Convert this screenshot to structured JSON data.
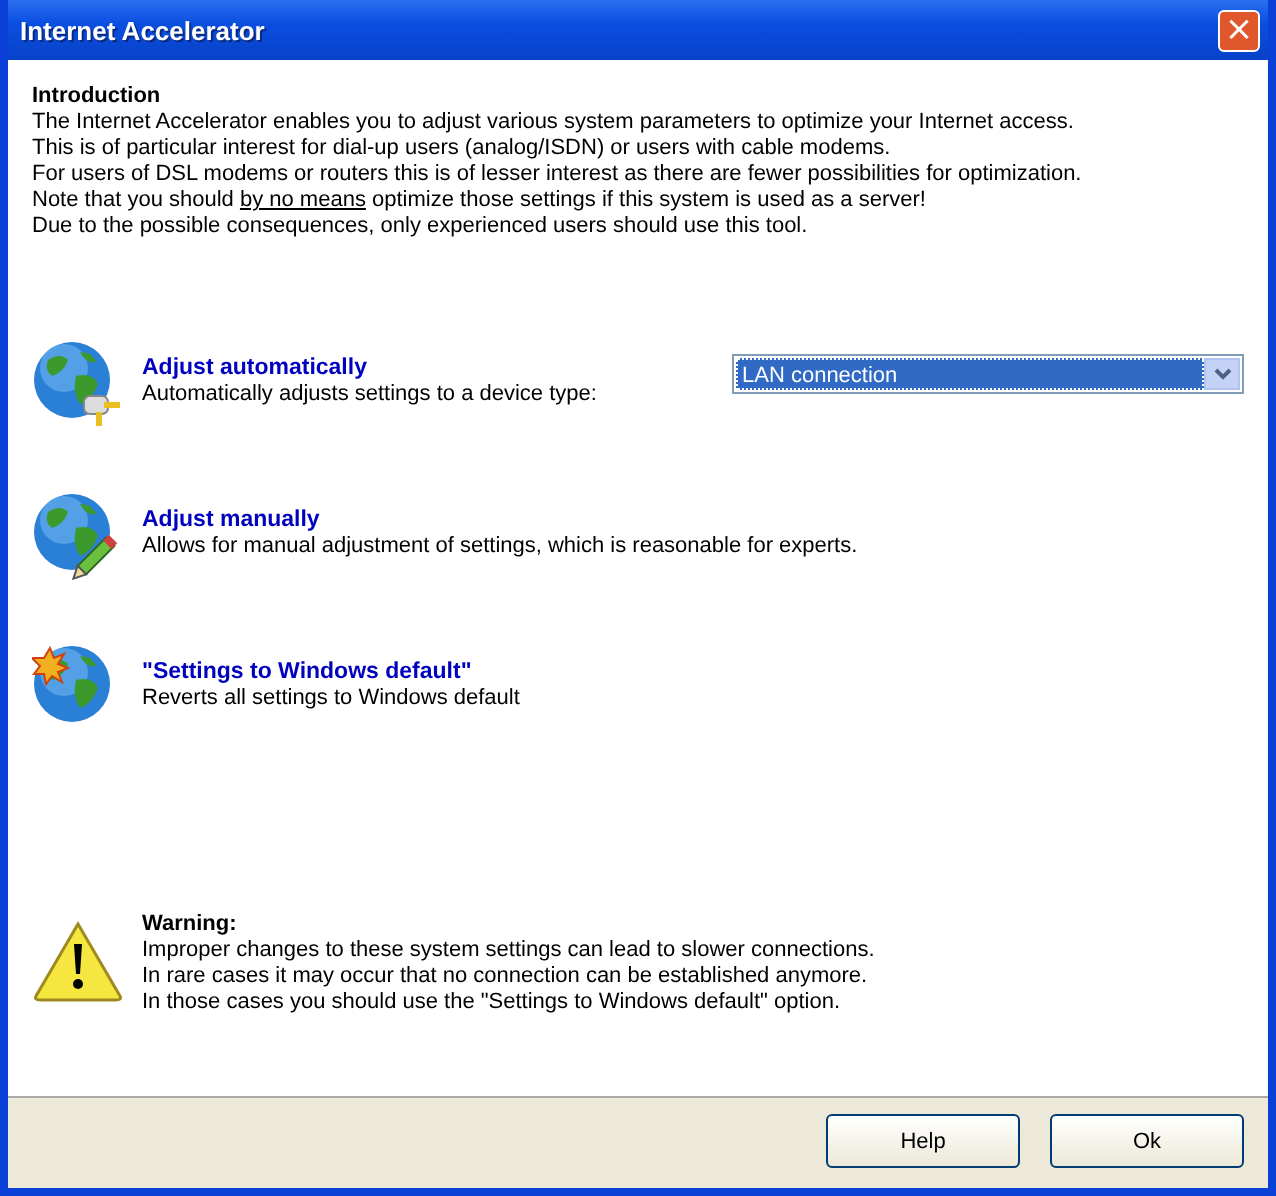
{
  "window": {
    "title": "Internet Accelerator",
    "close": "×"
  },
  "introduction": {
    "heading": "Introduction",
    "lines": [
      [
        {
          "text": "The Internet Accelerator enables you to adjust various system parameters to optimize your Internet access.",
          "underline": false
        }
      ],
      [
        {
          "text": "This is of particular interest for dial-up users (analog/ISDN) or users with cable modems.",
          "underline": false
        }
      ],
      [
        {
          "text": "For users of DSL modems or routers this is of lesser interest as there are fewer possibilities for optimization.",
          "underline": false
        }
      ],
      [
        {
          "text": "Note that you should ",
          "underline": false
        },
        {
          "text": "by no means",
          "underline": true
        },
        {
          "text": " optimize those settings if this system is used as a server!",
          "underline": false
        }
      ],
      [
        {
          "text": "Due to the possible consequences, only experienced users should use this tool.",
          "underline": false
        }
      ]
    ]
  },
  "actions": [
    {
      "kind": "auto",
      "title": "Adjust automatically",
      "description": "Automatically adjusts settings to a device type:",
      "dropdown": {
        "value": "LAN connection"
      }
    },
    {
      "kind": "manual",
      "title": "Adjust manually",
      "description": "Allows for manual adjustment of settings, which is reasonable for experts."
    },
    {
      "kind": "reset",
      "title": "\"Settings to Windows default\"",
      "description": "Reverts all settings to Windows default"
    }
  ],
  "warning": {
    "heading": "Warning:",
    "lines": [
      "Improper changes to these system settings can lead to slower connections.",
      "In rare cases it may occur that no connection can be established anymore.",
      "In those cases you should use the \"Settings to Windows default\" option."
    ]
  },
  "buttons": [
    "Help",
    "Ok"
  ]
}
